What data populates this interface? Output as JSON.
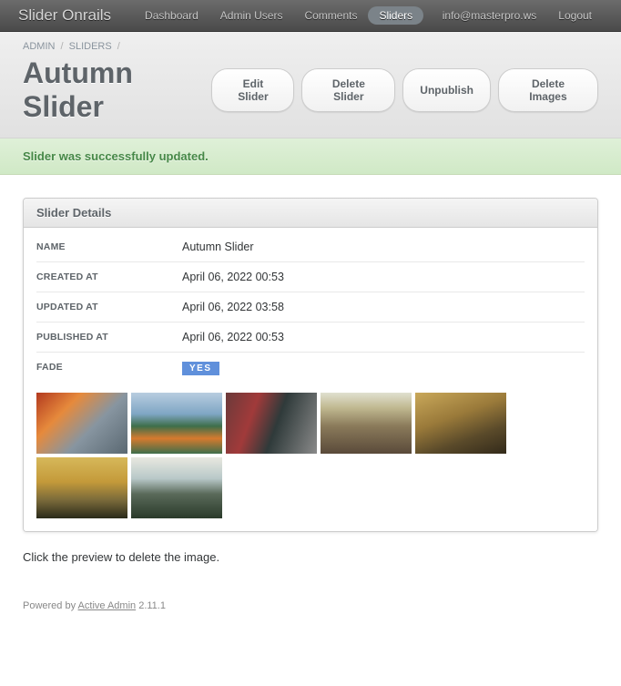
{
  "brand": "Slider Onrails",
  "nav": {
    "dashboard": "Dashboard",
    "admin_users": "Admin Users",
    "comments": "Comments",
    "sliders": "Sliders",
    "email": "info@masterpro.ws",
    "logout": "Logout"
  },
  "breadcrumb": {
    "admin": "ADMIN",
    "sliders": "SLIDERS"
  },
  "page_title": "Autumn Slider",
  "actions": {
    "edit": "Edit Slider",
    "delete": "Delete Slider",
    "unpublish": "Unpublish",
    "delete_images": "Delete Images"
  },
  "flash": "Slider was successfully updated.",
  "panel_title": "Slider Details",
  "details": {
    "name_label": "NAME",
    "name_value": "Autumn Slider",
    "created_label": "CREATED AT",
    "created_value": "April 06, 2022 00:53",
    "updated_label": "UPDATED AT",
    "updated_value": "April 06, 2022 03:58",
    "published_label": "PUBLISHED AT",
    "published_value": "April 06, 2022 00:53",
    "fade_label": "FADE",
    "fade_value": "YES"
  },
  "hint": "Click the preview to delete the image.",
  "footer": {
    "powered_by": "Powered by ",
    "link": "Active Admin",
    "version": " 2.11.1"
  }
}
